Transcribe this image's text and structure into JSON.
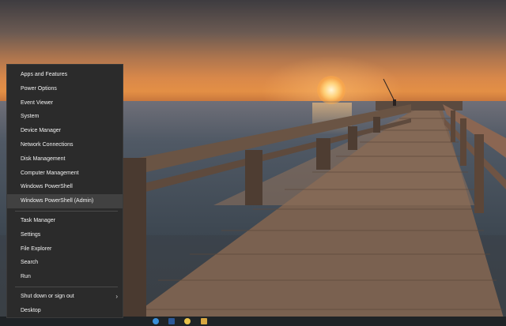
{
  "menu": {
    "group1": [
      {
        "label": "Apps and Features"
      },
      {
        "label": "Power Options"
      },
      {
        "label": "Event Viewer"
      },
      {
        "label": "System"
      },
      {
        "label": "Device Manager"
      },
      {
        "label": "Network Connections"
      },
      {
        "label": "Disk Management"
      },
      {
        "label": "Computer Management"
      },
      {
        "label": "Windows PowerShell"
      },
      {
        "label": "Windows PowerShell (Admin)"
      }
    ],
    "group2": [
      {
        "label": "Task Manager"
      },
      {
        "label": "Settings"
      },
      {
        "label": "File Explorer"
      },
      {
        "label": "Search"
      },
      {
        "label": "Run"
      }
    ],
    "group3": [
      {
        "label": "Shut down or sign out"
      },
      {
        "label": "Desktop"
      }
    ],
    "highlighted_item": "Windows PowerShell (Admin)"
  },
  "taskbar": {
    "icons": [
      "chrome-icon",
      "word-icon",
      "edge-icon",
      "app-icon"
    ]
  },
  "colors": {
    "menu_bg": "#2b2b2b",
    "menu_text": "#f2f2f2",
    "menu_hover": "#414141"
  }
}
